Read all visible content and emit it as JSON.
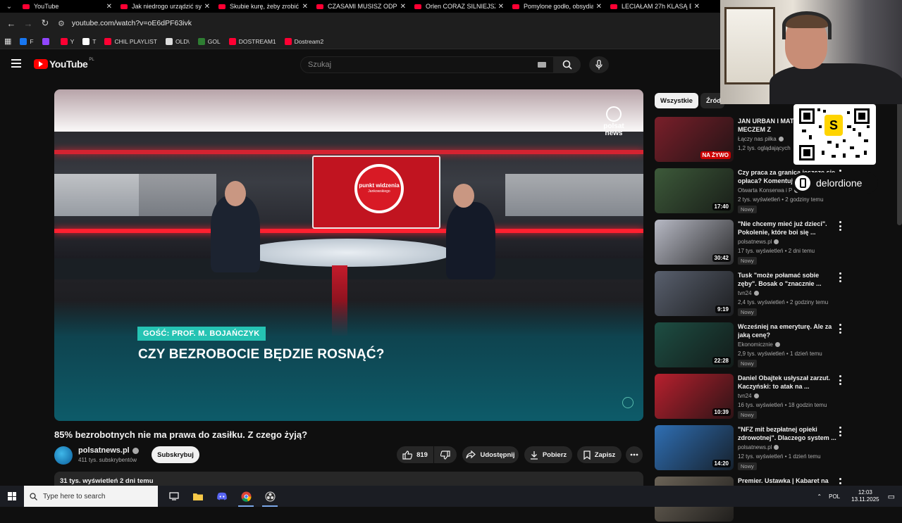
{
  "browser": {
    "tabs": [
      {
        "label": "YouTube",
        "active": true
      },
      {
        "label": "Jak niedrogo urządzić syp"
      },
      {
        "label": "Skubie kurę, żeby zrobić"
      },
      {
        "label": "CZASAMI MUSISZ ODPUS"
      },
      {
        "label": "Orlen CORAZ SILNIEJSZY"
      },
      {
        "label": "Pomylone godło, obsydia"
      },
      {
        "label": "LECIAŁAM 27h KLASĄ BIZ"
      }
    ],
    "url": "youtube.com/watch?v=oE6dPF63ivk",
    "bookmarks": [
      {
        "label": "F",
        "color": "#1877f2"
      },
      {
        "label": "",
        "color": "#9146ff"
      },
      {
        "label": "Y",
        "color": "#ff0033"
      },
      {
        "label": "T",
        "color": "#ffffff"
      },
      {
        "label": "CHIL PLAYLIST",
        "color": "#ff0033"
      },
      {
        "label": "OLD\\",
        "color": "#dddddd"
      },
      {
        "label": "GOL",
        "color": "#2e7d32"
      },
      {
        "label": "DOSTREAM1",
        "color": "#ff0033"
      },
      {
        "label": "Dostream2",
        "color": "#ff0033"
      }
    ]
  },
  "youtube": {
    "logo_text": "YouTube",
    "logo_region": "PL",
    "search_placeholder": "Szukaj"
  },
  "video": {
    "guest_label": "GOŚĆ: PROF. M. BOJAŃCZYK",
    "headline": "CZY BEZROBOCIE BĘDZIE ROSNĄĆ?",
    "screen_title": "punkt widzenia",
    "screen_subtitle": "Jankowskiego",
    "channel_logo_text": "polsat news",
    "title": "85% bezrobotnych nie ma prawa do zasiłku. Z czego żyją?",
    "channel": "polsatnews.pl",
    "subscribers": "411 tys. subskrybentów",
    "subscribe_label": "Subskrybuj",
    "likes": "819",
    "share_label": "Udostępnij",
    "download_label": "Pobierz",
    "save_label": "Zapisz",
    "description_meta": "31 tys. wyświetleń  2 dni temu"
  },
  "sidebar": {
    "chips": [
      "Wszystkie",
      "Źródło"
    ],
    "recommendations": [
      {
        "title": "JAN URBAN I MAT PRZED MECZEM Z",
        "channel": "Łączy nas piłka",
        "meta": "1,2 tys. oglądających",
        "duration": "",
        "badge": "",
        "live_label": "NA ŻYWO",
        "thumb_color": "#7a1f2a"
      },
      {
        "title": "Czy praca za granicą jeszcze się opłaca? Komentuj",
        "channel": "Otwarta Konserwa i P",
        "meta": "2 tys. wyświetleń • 2 godziny temu",
        "duration": "17:40",
        "badge": "Nowy",
        "thumb_color": "#3d5a3a"
      },
      {
        "title": "\"Nie chcemy mieć już dzieci\". Pokolenie, które boi się ...",
        "channel": "polsatnews.pl",
        "meta": "17 tys. wyświetleń • 2 dni temu",
        "duration": "30:42",
        "badge": "Nowy",
        "thumb_color": "#b7b9c4"
      },
      {
        "title": "Tusk \"może połamać sobie zęby\". Bosak o \"znacznie ...",
        "channel": "tvn24",
        "meta": "2,4 tys. wyświetleń • 2 godziny temu",
        "duration": "9:19",
        "badge": "Nowy",
        "thumb_color": "#59606e"
      },
      {
        "title": "Wcześniej na emeryturę. Ale za jaką cenę?",
        "channel": "Ekonomicznie",
        "meta": "2,9 tys. wyświetleń • 1 dzień temu",
        "duration": "22:28",
        "badge": "Nowy",
        "thumb_color": "#1d4e43"
      },
      {
        "title": "Daniel Obajtek usłyszał zarzut. Kaczyński: to atak na ...",
        "channel": "tvn24",
        "meta": "16 tys. wyświetleń • 18 godzin temu",
        "duration": "10:39",
        "badge": "Nowy",
        "thumb_color": "#b8202e"
      },
      {
        "title": "\"NFZ mit bezpłatnej opieki zdrowotnej\". Dlaczego system ...",
        "channel": "polsatnews.pl",
        "meta": "12 tys. wyświetleń • 1 dzień temu",
        "duration": "14:20",
        "badge": "Nowy",
        "thumb_color": "#2f6fb4"
      },
      {
        "title": "Premier. Ustawka | Kabaret na żywo. Nad morzą rzeka",
        "channel": "",
        "meta": "",
        "duration": "",
        "badge": "",
        "thumb_color": "#6b6357"
      }
    ]
  },
  "overlay": {
    "handle": "delordione"
  },
  "taskbar": {
    "search_placeholder": "Type here to search",
    "language": "POL",
    "time": "12:03",
    "date": "13.11.2025"
  }
}
